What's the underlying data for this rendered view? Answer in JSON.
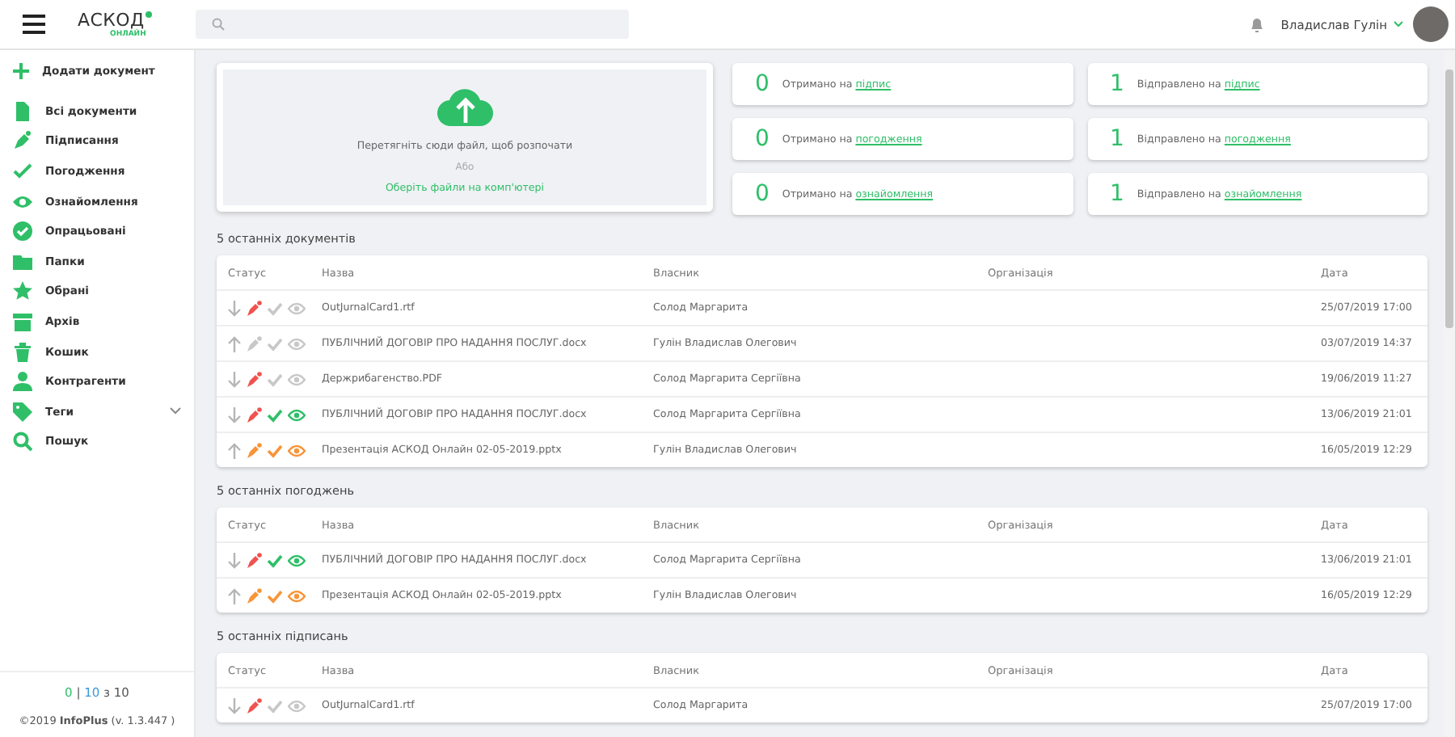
{
  "header": {
    "logo": "АСКОД",
    "logo_sub": "ОНЛАЙН",
    "user_name": "Владислав Гулін"
  },
  "sidebar": {
    "add_label": "Додати документ",
    "items": [
      {
        "kind": "doc",
        "label": "Всі документи",
        "selected": false
      },
      {
        "kind": "sign",
        "label": "Підписання",
        "selected": false
      },
      {
        "kind": "check",
        "label": "Погодження",
        "selected": false
      },
      {
        "kind": "eye",
        "label": "Ознайомлення",
        "selected": false
      },
      {
        "kind": "done",
        "label": "Опрацьовані",
        "selected": false
      },
      {
        "kind": "folder",
        "label": "Папки",
        "selected": false
      },
      {
        "kind": "star",
        "label": "Обрані",
        "selected": false
      },
      {
        "kind": "archive",
        "label": "Архів",
        "selected": false
      },
      {
        "kind": "trash",
        "label": "Кошик",
        "selected": false
      },
      {
        "kind": "person",
        "label": "Контрагенти",
        "selected": false
      },
      {
        "kind": "tag",
        "label": "Теги",
        "selected": false,
        "expandable": true
      },
      {
        "kind": "search",
        "label": "Пошук",
        "selected": false
      }
    ],
    "counter": {
      "first": "0",
      "sep": "|",
      "second": "10",
      "of": "з 10"
    },
    "footer": {
      "year": "©2019",
      "company": "InfoPlus",
      "version": "(v. 1.3.447 )"
    }
  },
  "upload": {
    "hint": "Перетягніть сюди файл, щоб розпочати",
    "or": "Або",
    "link": "Оберіть файли на комп'ютері"
  },
  "stats": [
    {
      "count": "0",
      "text": "Отримано на",
      "link": "підпис"
    },
    {
      "count": "1",
      "text": "Відправлено на",
      "link": "підпис"
    },
    {
      "count": "0",
      "text": "Отримано на",
      "link": "погодження"
    },
    {
      "count": "1",
      "text": "Відправлено на",
      "link": "погодження"
    },
    {
      "count": "0",
      "text": "Отримано на",
      "link": "ознайомлення"
    },
    {
      "count": "1",
      "text": "Відправлено на",
      "link": "ознайомлення"
    }
  ],
  "sections": [
    {
      "title": "5 останніх документів",
      "columns": [
        "Статус",
        "Назва",
        "Власник",
        "Організація",
        "Дата"
      ],
      "rows": [
        {
          "icons": [
            {
              "kind": "arrowdown"
            },
            {
              "kind": "pen",
              "color": "#f0524f"
            },
            {
              "kind": "check",
              "color": "#c8c8c8"
            },
            {
              "kind": "eye",
              "color": "#c8c8c8"
            }
          ],
          "name": "OutJurnalCard1.rtf",
          "owner": "Солод Маргарита",
          "date": "25/07/2019 17:00"
        },
        {
          "icons": [
            {
              "kind": "arrowup"
            },
            {
              "kind": "pen",
              "color": "#c8c8c8"
            },
            {
              "kind": "check",
              "color": "#c8c8c8"
            },
            {
              "kind": "eye",
              "color": "#c8c8c8"
            }
          ],
          "name": "ПУБЛІЧНИЙ ДОГОВІР ПРО НАДАННЯ ПОСЛУГ.docx",
          "owner": "Гулін Владислав Олегович",
          "date": "03/07/2019 14:37"
        },
        {
          "icons": [
            {
              "kind": "arrowdown"
            },
            {
              "kind": "pen",
              "color": "#f0524f"
            },
            {
              "kind": "check",
              "color": "#c8c8c8"
            },
            {
              "kind": "eye",
              "color": "#c8c8c8"
            }
          ],
          "name": "Держрибагенство.PDF",
          "owner": "Солод Маргарита Сергіївна",
          "date": "19/06/2019 11:27"
        },
        {
          "icons": [
            {
              "kind": "arrowdown"
            },
            {
              "kind": "pen",
              "color": "#f0524f"
            },
            {
              "kind": "check",
              "color": "#2fbf68"
            },
            {
              "kind": "eye",
              "color": "#2fbf68"
            }
          ],
          "name": "ПУБЛІЧНИЙ ДОГОВІР ПРО НАДАННЯ ПОСЛУГ.docx",
          "owner": "Солод Маргарита Сергіївна",
          "date": "13/06/2019 21:01"
        },
        {
          "icons": [
            {
              "kind": "arrowup"
            },
            {
              "kind": "pen",
              "color": "#f7953a"
            },
            {
              "kind": "check",
              "color": "#f7953a"
            },
            {
              "kind": "eye",
              "color": "#f7953a"
            }
          ],
          "name": "Презентація АСКОД Онлайн 02-05-2019.pptx",
          "owner": "Гулін Владислав Олегович",
          "date": "16/05/2019 12:29"
        }
      ]
    },
    {
      "title": "5 останніх погоджень",
      "columns": [
        "Статус",
        "Назва",
        "Власник",
        "Організація",
        "Дата"
      ],
      "rows": [
        {
          "icons": [
            {
              "kind": "arrowdown"
            },
            {
              "kind": "pen",
              "color": "#f0524f"
            },
            {
              "kind": "check",
              "color": "#2fbf68"
            },
            {
              "kind": "eye",
              "color": "#2fbf68"
            }
          ],
          "name": "ПУБЛІЧНИЙ ДОГОВІР ПРО НАДАННЯ ПОСЛУГ.docx",
          "owner": "Солод Маргарита Сергіївна",
          "date": "13/06/2019 21:01"
        },
        {
          "icons": [
            {
              "kind": "arrowup"
            },
            {
              "kind": "pen",
              "color": "#f7953a"
            },
            {
              "kind": "check",
              "color": "#f7953a"
            },
            {
              "kind": "eye",
              "color": "#f7953a"
            }
          ],
          "name": "Презентація АСКОД Онлайн 02-05-2019.pptx",
          "owner": "Гулін Владислав Олегович",
          "date": "16/05/2019 12:29"
        }
      ]
    },
    {
      "title": "5 останніх підписань",
      "columns": [
        "Статус",
        "Назва",
        "Власник",
        "Організація",
        "Дата"
      ],
      "rows": [
        {
          "icons": [
            {
              "kind": "arrowdown"
            },
            {
              "kind": "pen",
              "color": "#f0524f"
            },
            {
              "kind": "check",
              "color": "#c8c8c8"
            },
            {
              "kind": "eye",
              "color": "#c8c8c8"
            }
          ],
          "name": "OutJurnalCard1.rtf",
          "owner": "Солод Маргарита",
          "date": "25/07/2019 17:00"
        }
      ]
    }
  ]
}
